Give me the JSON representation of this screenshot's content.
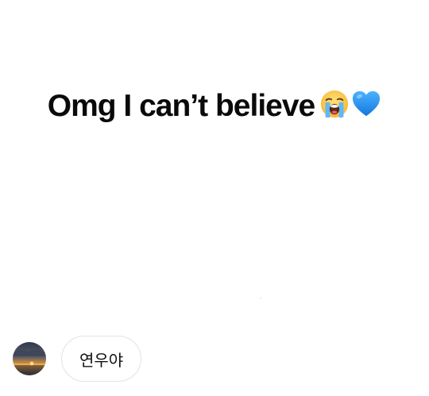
{
  "post": {
    "text": "Omg I can’t believe",
    "emojis": [
      "loudly-crying-face-icon",
      "blue-heart-icon"
    ]
  },
  "message": {
    "text": "연우야",
    "avatar": "sunset-avatar"
  },
  "colors": {
    "background": "#ffffff",
    "text": "#0a0a0a",
    "bubble_border": "#e2e2e2",
    "heart": "#1d8ff0"
  }
}
